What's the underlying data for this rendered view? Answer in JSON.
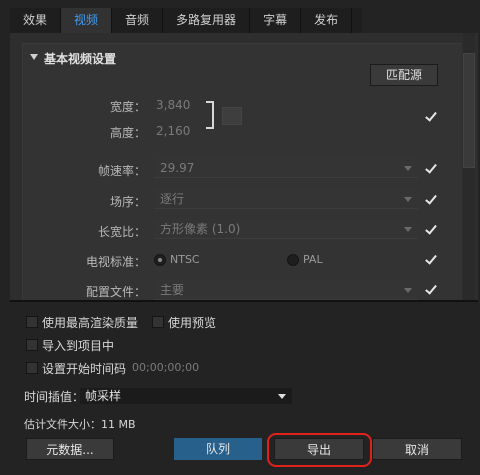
{
  "tabs": [
    {
      "label": "效果",
      "active": false
    },
    {
      "label": "视频",
      "active": true
    },
    {
      "label": "音频",
      "active": false
    },
    {
      "label": "多路复用器",
      "active": false
    },
    {
      "label": "字幕",
      "active": false
    },
    {
      "label": "发布",
      "active": false
    }
  ],
  "section": {
    "title": "基本视频设置",
    "match_source_label": "匹配源"
  },
  "fields": {
    "width_label": "宽度：",
    "width_value": "3,840",
    "height_label": "高度：",
    "height_value": "2,160",
    "framerate_label": "帧速率：",
    "framerate_value": "29.97",
    "field_order_label": "场序：",
    "field_order_value": "逐行",
    "aspect_label": "长宽比：",
    "aspect_value": "方形像素 (1.0)",
    "tv_standard_label": "电视标准：",
    "ntsc_label": "NTSC",
    "pal_label": "PAL",
    "profile_label": "配置文件：",
    "profile_value": "主要"
  },
  "options": {
    "max_render_quality": "使用最高渲染质量",
    "use_previews": "使用预览",
    "import_into_project": "导入到项目中",
    "set_start_timecode": "设置开始时间码",
    "timecode_value": "00;00;00;00",
    "time_interp_label": "时间插值：",
    "time_interp_value": "帧采样",
    "estimated_size": "估计文件大小：11 MB"
  },
  "buttons": {
    "metadata": "元数据...",
    "queue": "队列",
    "export": "导出",
    "cancel": "取消"
  },
  "colors": {
    "active_tab": "#3f9cf3",
    "queue_button": "#27608b",
    "highlight": "#e0221b"
  }
}
